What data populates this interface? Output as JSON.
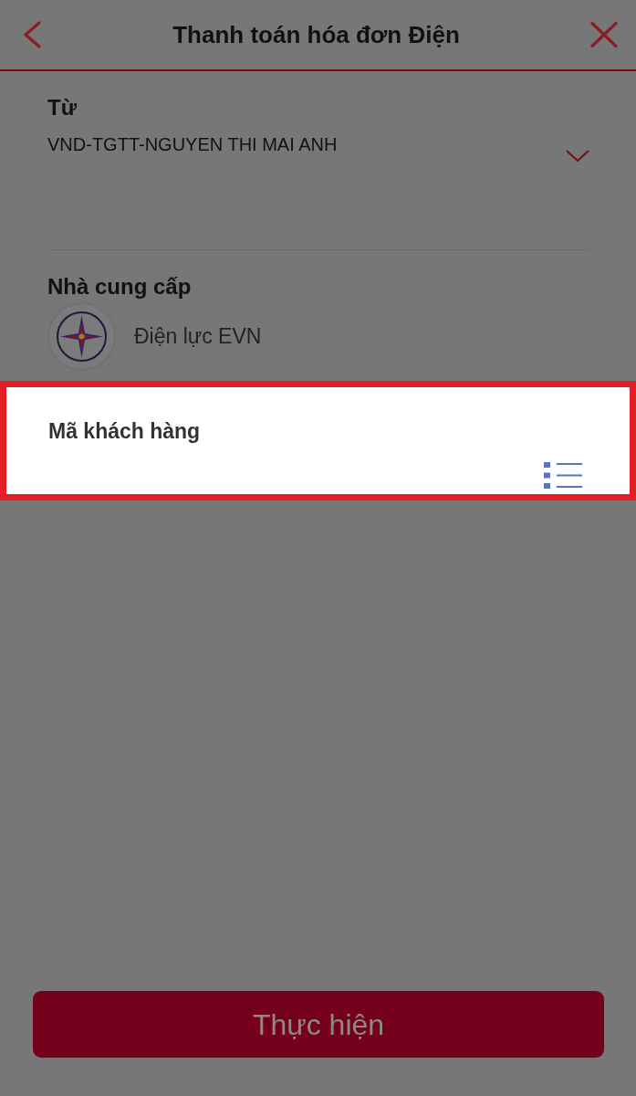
{
  "header": {
    "title": "Thanh toán hóa đơn Điện"
  },
  "from_account": {
    "label": "Từ",
    "value": "VND-TGTT-NGUYEN THI MAI ANH"
  },
  "provider": {
    "label": "Nhà cung cấp",
    "name": "Điện lực EVN"
  },
  "customer_code": {
    "label": "Mã khách hàng",
    "highlighted": true
  },
  "submit_button": {
    "label": "Thực hiện"
  }
}
